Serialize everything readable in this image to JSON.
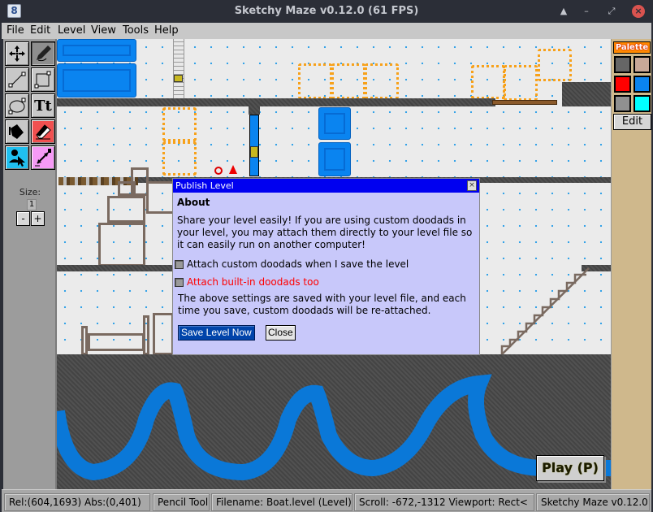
{
  "window": {
    "title": "Sketchy Maze v0.12.0 (61 FPS)",
    "icon": "app-logo-icon",
    "controls": [
      "shade-icon",
      "minimize-icon",
      "maximize-icon",
      "close-icon"
    ],
    "icon_glyphs": {
      "shade": "▲",
      "minimize": "–",
      "maximize": "⤢",
      "close": "×",
      "app": "8"
    }
  },
  "menu": {
    "items": [
      {
        "label": "File"
      },
      {
        "label": "Edit"
      },
      {
        "label": "Level"
      },
      {
        "label": "View"
      },
      {
        "label": "Tools"
      },
      {
        "label": "Help"
      }
    ]
  },
  "tools": {
    "items": [
      {
        "name": "pan-tool",
        "icon": "move-arrows-icon",
        "active": false
      },
      {
        "name": "pencil-tool",
        "icon": "pencil-icon",
        "active": true
      },
      {
        "name": "line-tool",
        "icon": "line-icon",
        "active": false
      },
      {
        "name": "rectangle-tool",
        "icon": "rectangle-icon",
        "active": false
      },
      {
        "name": "ellipse-tool",
        "icon": "ellipse-icon",
        "active": false
      },
      {
        "name": "text-tool",
        "icon": "text-icon",
        "label": "Tt",
        "active": false
      },
      {
        "name": "fill-tool",
        "icon": "paint-bucket-icon",
        "active": false
      },
      {
        "name": "eraser-tool",
        "icon": "eraser-icon",
        "active": false
      },
      {
        "name": "actor-tool",
        "icon": "actor-select-icon",
        "active": false
      },
      {
        "name": "link-tool",
        "icon": "link-icon",
        "active": false
      }
    ],
    "size_label": "Size:",
    "size_value": "1",
    "size_decrease": "-",
    "size_increase": "+"
  },
  "palette": {
    "label": "Palette",
    "swatches": [
      {
        "name": "ground",
        "color": "#666666"
      },
      {
        "name": "wall",
        "color": "#c8a898"
      },
      {
        "name": "fire",
        "color": "#ff0000"
      },
      {
        "name": "water",
        "color": "#0a84f0"
      },
      {
        "name": "stone",
        "color": "#909090"
      },
      {
        "name": "cyan",
        "color": "#00ffff"
      }
    ],
    "edit_label": "Edit"
  },
  "dialog": {
    "title": "Publish Level",
    "close_glyph": "×",
    "heading": "About",
    "body": "Share your level easily! If you are using custom doodads in your level, you may attach them directly to your level file so it can easily run on another computer!",
    "options": [
      {
        "label": "Attach custom doodads when I save the level",
        "checked": false,
        "color": "#000000"
      },
      {
        "label": "Attach built-in doodads too",
        "checked": false,
        "color": "#ff0000"
      }
    ],
    "note": "The above settings are saved with your level file, and each time you save, custom doodads will be re-attached.",
    "save_label": "Save Level Now",
    "close_label": "Close"
  },
  "canvas": {
    "play_label": "Play (P)"
  },
  "status": {
    "rel": "Rel:(604,1693)  Abs:(0,401)",
    "tool": "Pencil Tool",
    "filename": "Filename: Boat.level (Level)",
    "scroll": "Scroll: -672,-1312   Viewport: Rect<",
    "version": "Sketchy Maze v0.12.0"
  }
}
